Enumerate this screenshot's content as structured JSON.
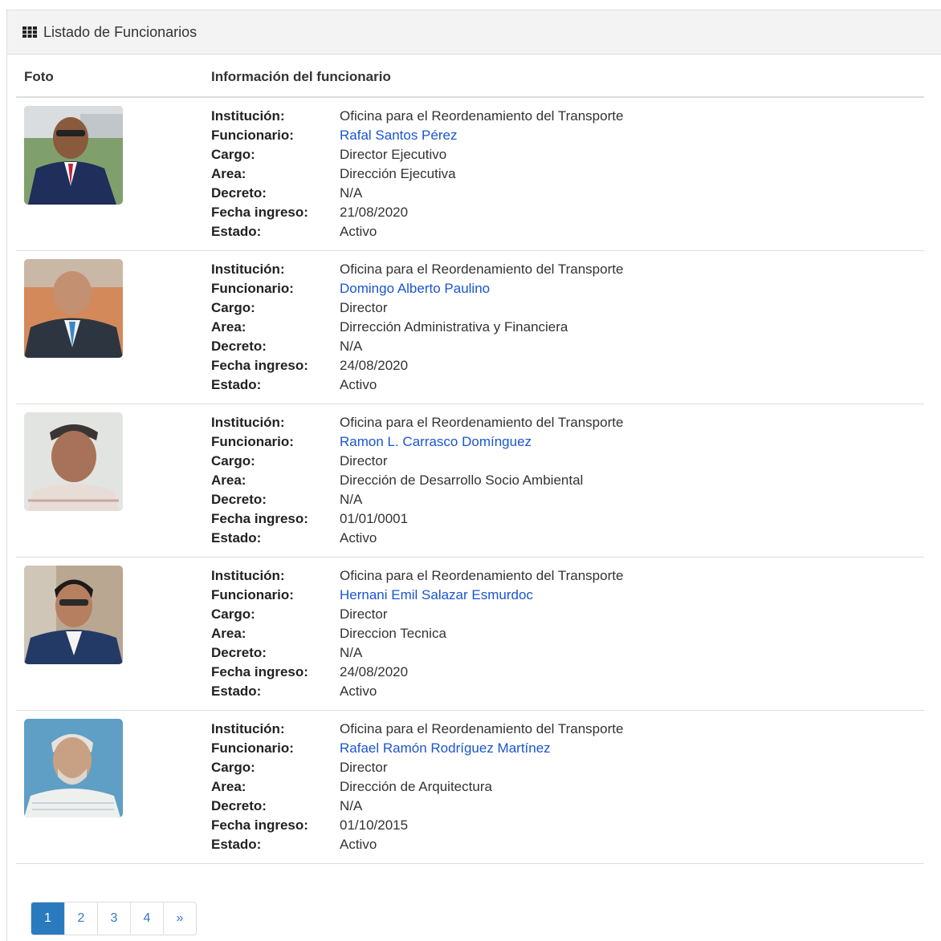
{
  "panel": {
    "title": "Listado de Funcionarios"
  },
  "table": {
    "col_foto": "Foto",
    "col_info": "Información del funcionario"
  },
  "labels": {
    "institucion": "Institución:",
    "funcionario": "Funcionario:",
    "cargo": "Cargo:",
    "area": "Area:",
    "decreto": "Decreto:",
    "fecha": "Fecha ingreso:",
    "estado": "Estado:"
  },
  "rows": [
    {
      "institucion": "Oficina para el Reordenamiento del Transporte",
      "funcionario": "Rafal Santos Pérez",
      "cargo": "Director Ejecutivo",
      "area": "Dirección Ejecutiva",
      "decreto": "N/A",
      "fecha": "21/08/2020",
      "estado": "Activo"
    },
    {
      "institucion": "Oficina para el Reordenamiento del Transporte",
      "funcionario": "Domingo Alberto Paulino",
      "cargo": "Director",
      "area": "Dirrección Administrativa y Financiera",
      "decreto": "N/A",
      "fecha": "24/08/2020",
      "estado": "Activo"
    },
    {
      "institucion": "Oficina para el Reordenamiento del Transporte",
      "funcionario": "Ramon L. Carrasco Domínguez",
      "cargo": "Director",
      "area": "Dirección de Desarrollo Socio Ambiental",
      "decreto": "N/A",
      "fecha": "01/01/0001",
      "estado": "Activo"
    },
    {
      "institucion": "Oficina para el Reordenamiento del Transporte",
      "funcionario": "Hernani Emil Salazar Esmurdoc",
      "cargo": "Director",
      "area": "Direccion Tecnica",
      "decreto": "N/A",
      "fecha": "24/08/2020",
      "estado": "Activo"
    },
    {
      "institucion": "Oficina para el Reordenamiento del Transporte",
      "funcionario": "Rafael Ramón Rodríguez Martínez",
      "cargo": "Director",
      "area": "Dirección de Arquitectura",
      "decreto": "N/A",
      "fecha": "01/10/2015",
      "estado": "Activo"
    }
  ],
  "pagination": {
    "pages": [
      "1",
      "2",
      "3",
      "4"
    ],
    "next": "»",
    "active": "1"
  },
  "colors": {
    "link": "#1a55d1",
    "active_page": "#2a7ac0"
  }
}
